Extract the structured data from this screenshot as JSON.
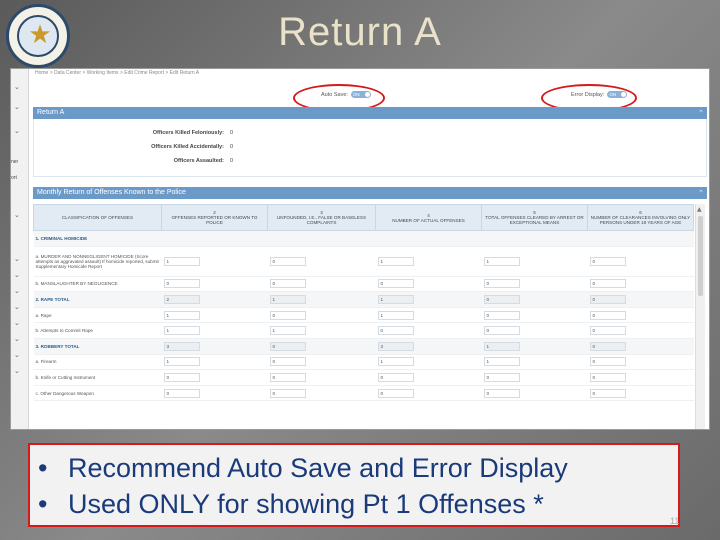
{
  "slide": {
    "title": "Return A",
    "bullets": [
      "Recommend Auto Save and Error Display",
      "Used ONLY for showing Pt 1 Offenses *"
    ],
    "page_number": "11",
    "highlight_color": "#d41a1a"
  },
  "app": {
    "breadcrumb": "Home  >  Data Center  >  Working Items  >  Edit Crime Report  >  Edit Return A",
    "auto_save_label": "Auto Save:",
    "auto_save_state": "ON",
    "error_display_label": "Error Display:",
    "error_display_state": "ON",
    "left_rail_items": [
      "ner",
      "ort"
    ],
    "panel_return_a": {
      "title": "Return A",
      "rows": [
        {
          "label": "Officers Killed Feloniously:",
          "value": "0"
        },
        {
          "label": "Officers Killed Accidentally:",
          "value": "0"
        },
        {
          "label": "Officers Assaulted:",
          "value": "0"
        }
      ]
    },
    "panel_monthly": {
      "title": "Monthly Return of Offenses Known to the Police",
      "columns": [
        {
          "num": "",
          "label": "CLASSIFICATION OF OFFENSES"
        },
        {
          "num": "2",
          "label": "OFFENSES REPORTED OR KNOWN TO POLICE"
        },
        {
          "num": "3",
          "label": "UNFOUNDED, I.E., FALSE OR BASELESS COMPLAINTS"
        },
        {
          "num": "4",
          "label": "NUMBER OF ACTUAL OFFENSES"
        },
        {
          "num": "5",
          "label": "TOTAL OFFENSES CLEARED BY ARREST OR EXCEPTIONAL MEANS"
        },
        {
          "num": "6",
          "label": "NUMBER OF CLEARANCES INVOLVING ONLY PERSONS UNDER 18 YEARS OF AGE"
        }
      ],
      "rows": [
        {
          "label": "1. CRIMINAL HOMICIDE",
          "total": true,
          "values": []
        },
        {
          "label": "a. MURDER AND NONNEGLIGENT HOMICIDE (Score attempts as aggravated assault) If homicide reported, submit Supplementary Homicide Report",
          "total": false,
          "values": [
            "1",
            "0",
            "1",
            "1",
            "0"
          ]
        },
        {
          "label": "b. MANSLAUGHTER BY NEGLIGENCE",
          "total": false,
          "values": [
            "0",
            "0",
            "0",
            "0",
            "0"
          ]
        },
        {
          "label": "2. RAPE TOTAL",
          "total": true,
          "values": [
            "2",
            "1",
            "1",
            "0",
            "0"
          ]
        },
        {
          "label": "a. Rape",
          "total": false,
          "values": [
            "1",
            "0",
            "1",
            "0",
            "0"
          ]
        },
        {
          "label": "b. Attempts to Commit Rape",
          "total": false,
          "values": [
            "1",
            "1",
            "0",
            "0",
            "0"
          ]
        },
        {
          "label": "3. ROBBERY TOTAL",
          "total": true,
          "values": [
            "3",
            "0",
            "3",
            "1",
            "0"
          ]
        },
        {
          "label": "a. Firearm",
          "total": false,
          "values": [
            "1",
            "0",
            "1",
            "1",
            "0"
          ]
        },
        {
          "label": "b. Knife or Cutting Instrument",
          "total": false,
          "values": [
            "0",
            "0",
            "0",
            "0",
            "0"
          ]
        },
        {
          "label": "c. Other Dangerous Weapon",
          "total": false,
          "values": [
            "0",
            "0",
            "0",
            "0",
            "0"
          ]
        }
      ]
    }
  },
  "colors": {
    "panel_header": "#6b9ac9",
    "title_text": "#eae2c8",
    "bullet_text": "#1a3a7a"
  },
  "icons": [
    "state-seal-logo",
    "chevron-down-icon",
    "chevron-up-icon"
  ]
}
